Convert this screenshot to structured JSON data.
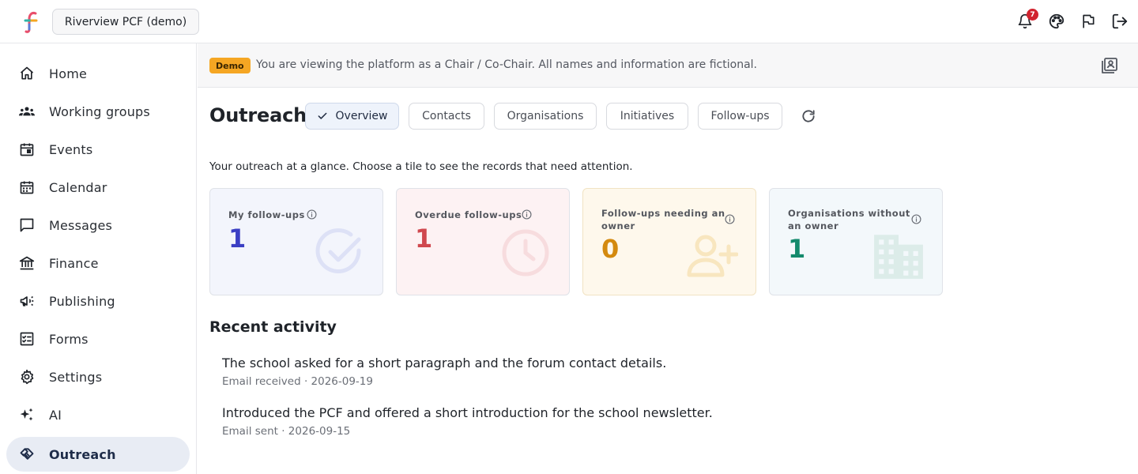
{
  "app": {
    "org_name": "Riverview PCF (demo)",
    "notification_count": "7"
  },
  "sidebar": {
    "items": [
      {
        "label": "Home",
        "icon": "home-icon"
      },
      {
        "label": "Working groups",
        "icon": "people-icon"
      },
      {
        "label": "Events",
        "icon": "event-icon"
      },
      {
        "label": "Calendar",
        "icon": "calendar-icon"
      },
      {
        "label": "Messages",
        "icon": "message-icon"
      },
      {
        "label": "Finance",
        "icon": "bank-icon"
      },
      {
        "label": "Publishing",
        "icon": "megaphone-icon"
      },
      {
        "label": "Forms",
        "icon": "checklist-icon"
      },
      {
        "label": "Settings",
        "icon": "gear-icon"
      },
      {
        "label": "AI",
        "icon": "sparkle-icon"
      },
      {
        "label": "Outreach",
        "icon": "handshake-icon",
        "active": true
      }
    ]
  },
  "banner": {
    "badge": "Demo",
    "text": "You are viewing the platform as a Chair / Co-Chair. All names and information are fictional."
  },
  "header": {
    "title": "Outreach",
    "tabs": [
      {
        "label": "Overview",
        "active": true
      },
      {
        "label": "Contacts"
      },
      {
        "label": "Organisations"
      },
      {
        "label": "Initiatives"
      },
      {
        "label": "Follow-ups"
      }
    ]
  },
  "subtitle": "Your outreach at a glance. Choose a tile to see the records that need attention.",
  "tiles": [
    {
      "label": "My follow-ups",
      "value": "1",
      "color": "#3b3fc4",
      "bg": "#f3f5fc",
      "icon": "check-circle-icon"
    },
    {
      "label": "Overdue follow-ups",
      "value": "1",
      "color": "#d0484e",
      "bg": "#fdf2f3",
      "icon": "clock-icon"
    },
    {
      "label": "Follow-ups needing an owner",
      "value": "0",
      "color": "#d48a0f",
      "bg": "#fef8ec",
      "icon": "add-person-icon"
    },
    {
      "label": "Organisations without an owner",
      "value": "1",
      "color": "#138a6c",
      "bg": "#f3f8fb",
      "icon": "building-icon"
    }
  ],
  "recent_activity": {
    "title": "Recent activity",
    "items": [
      {
        "title": "The school asked for a short paragraph and the forum contact details.",
        "meta": "Email received · 2026-09-19"
      },
      {
        "title": "Introduced the PCF and offered a short introduction for the school newsletter.",
        "meta": "Email sent · 2026-09-15"
      }
    ]
  }
}
